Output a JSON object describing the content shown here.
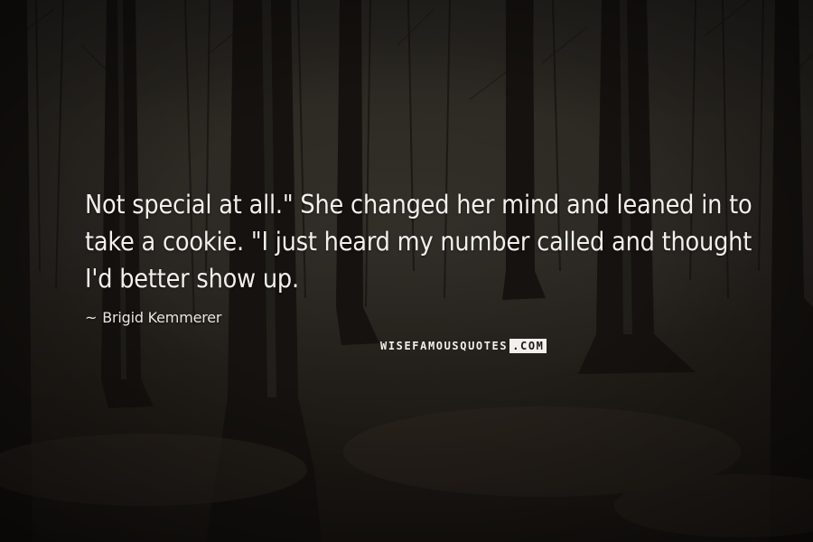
{
  "quote": {
    "text": "Not special at all.\" She changed her mind and leaned in to take a cookie. \"I just heard my number called and thought I'd better show up."
  },
  "author": {
    "prefix": "~",
    "name": "Brigid Kemmerer"
  },
  "brand": {
    "part_a": "WISEFAMOUSQUOTES",
    "part_b": ".COM"
  },
  "colors": {
    "text": "#f2f0ec",
    "background": "#1c1915"
  }
}
